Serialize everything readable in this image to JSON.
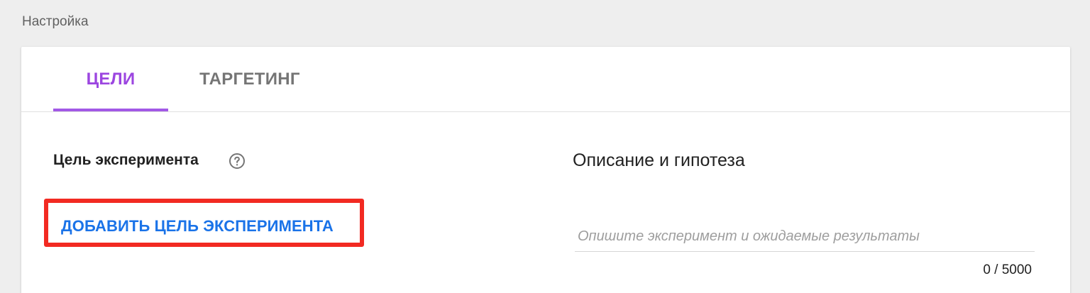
{
  "section": {
    "title": "Настройка"
  },
  "tabs": [
    {
      "label": "ЦЕЛИ",
      "active": true
    },
    {
      "label": "ТАРГЕТИНГ",
      "active": false
    }
  ],
  "goal": {
    "label": "Цель эксперимента",
    "help_icon": "question-circle-icon",
    "add_button_label": "ДОБАВИТЬ ЦЕЛЬ ЭКСПЕРИМЕНТА"
  },
  "description": {
    "heading": "Описание и гипотеза",
    "value": "",
    "placeholder": "Опишите эксперимент и ожидаемые результаты",
    "counter": "0 / 5000"
  },
  "colors": {
    "accent": "#9c46e0",
    "link": "#1a73e8",
    "highlight": "#f22a22"
  }
}
